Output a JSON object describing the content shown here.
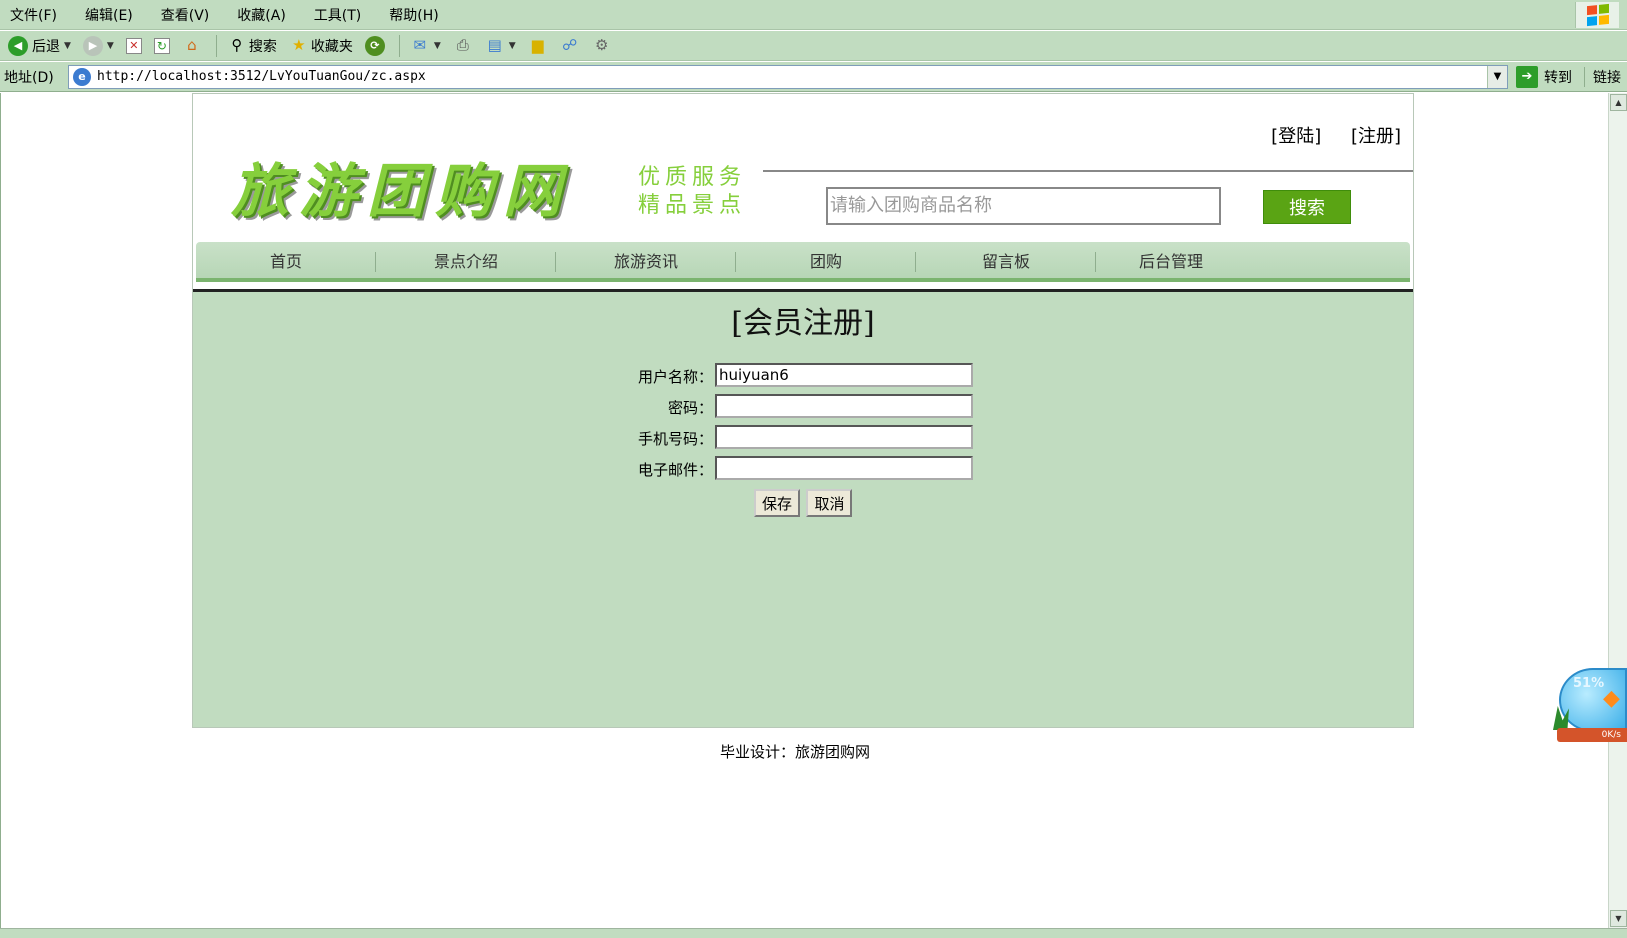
{
  "browser": {
    "menu": [
      "文件(F)",
      "编辑(E)",
      "查看(V)",
      "收藏(A)",
      "工具(T)",
      "帮助(H)"
    ],
    "toolbar": {
      "back": "后退",
      "search": "搜索",
      "favorites": "收藏夹"
    },
    "address": {
      "label": "地址(D)",
      "url": "http://localhost:3512/LvYouTuanGou/zc.aspx",
      "go": "转到",
      "links": "链接"
    }
  },
  "site": {
    "top_links": [
      "[登陆]",
      "[注册]"
    ],
    "logo_text": "旅游团购网",
    "slogan": [
      "优质服务",
      "精品景点"
    ],
    "search_placeholder": "请输入团购商品名称",
    "search_button": "搜索",
    "nav": [
      "首页",
      "景点介绍",
      "旅游资讯",
      "团购",
      "留言板",
      "后台管理"
    ]
  },
  "form": {
    "title": "[会员注册]",
    "fields": [
      {
        "label": "用户名称：",
        "value": "huiyuan6"
      },
      {
        "label": "密码：",
        "value": ""
      },
      {
        "label": "手机号码：",
        "value": ""
      },
      {
        "label": "电子邮件：",
        "value": ""
      }
    ],
    "save": "保存",
    "cancel": "取消"
  },
  "footer": "毕业设计：旅游团购网",
  "widget": {
    "percent": "51%",
    "speed": "0K/s"
  },
  "colors": {
    "chrome": "#c1dcc0",
    "accent_green": "#5aa414",
    "logo_green": "#86cf3c"
  }
}
